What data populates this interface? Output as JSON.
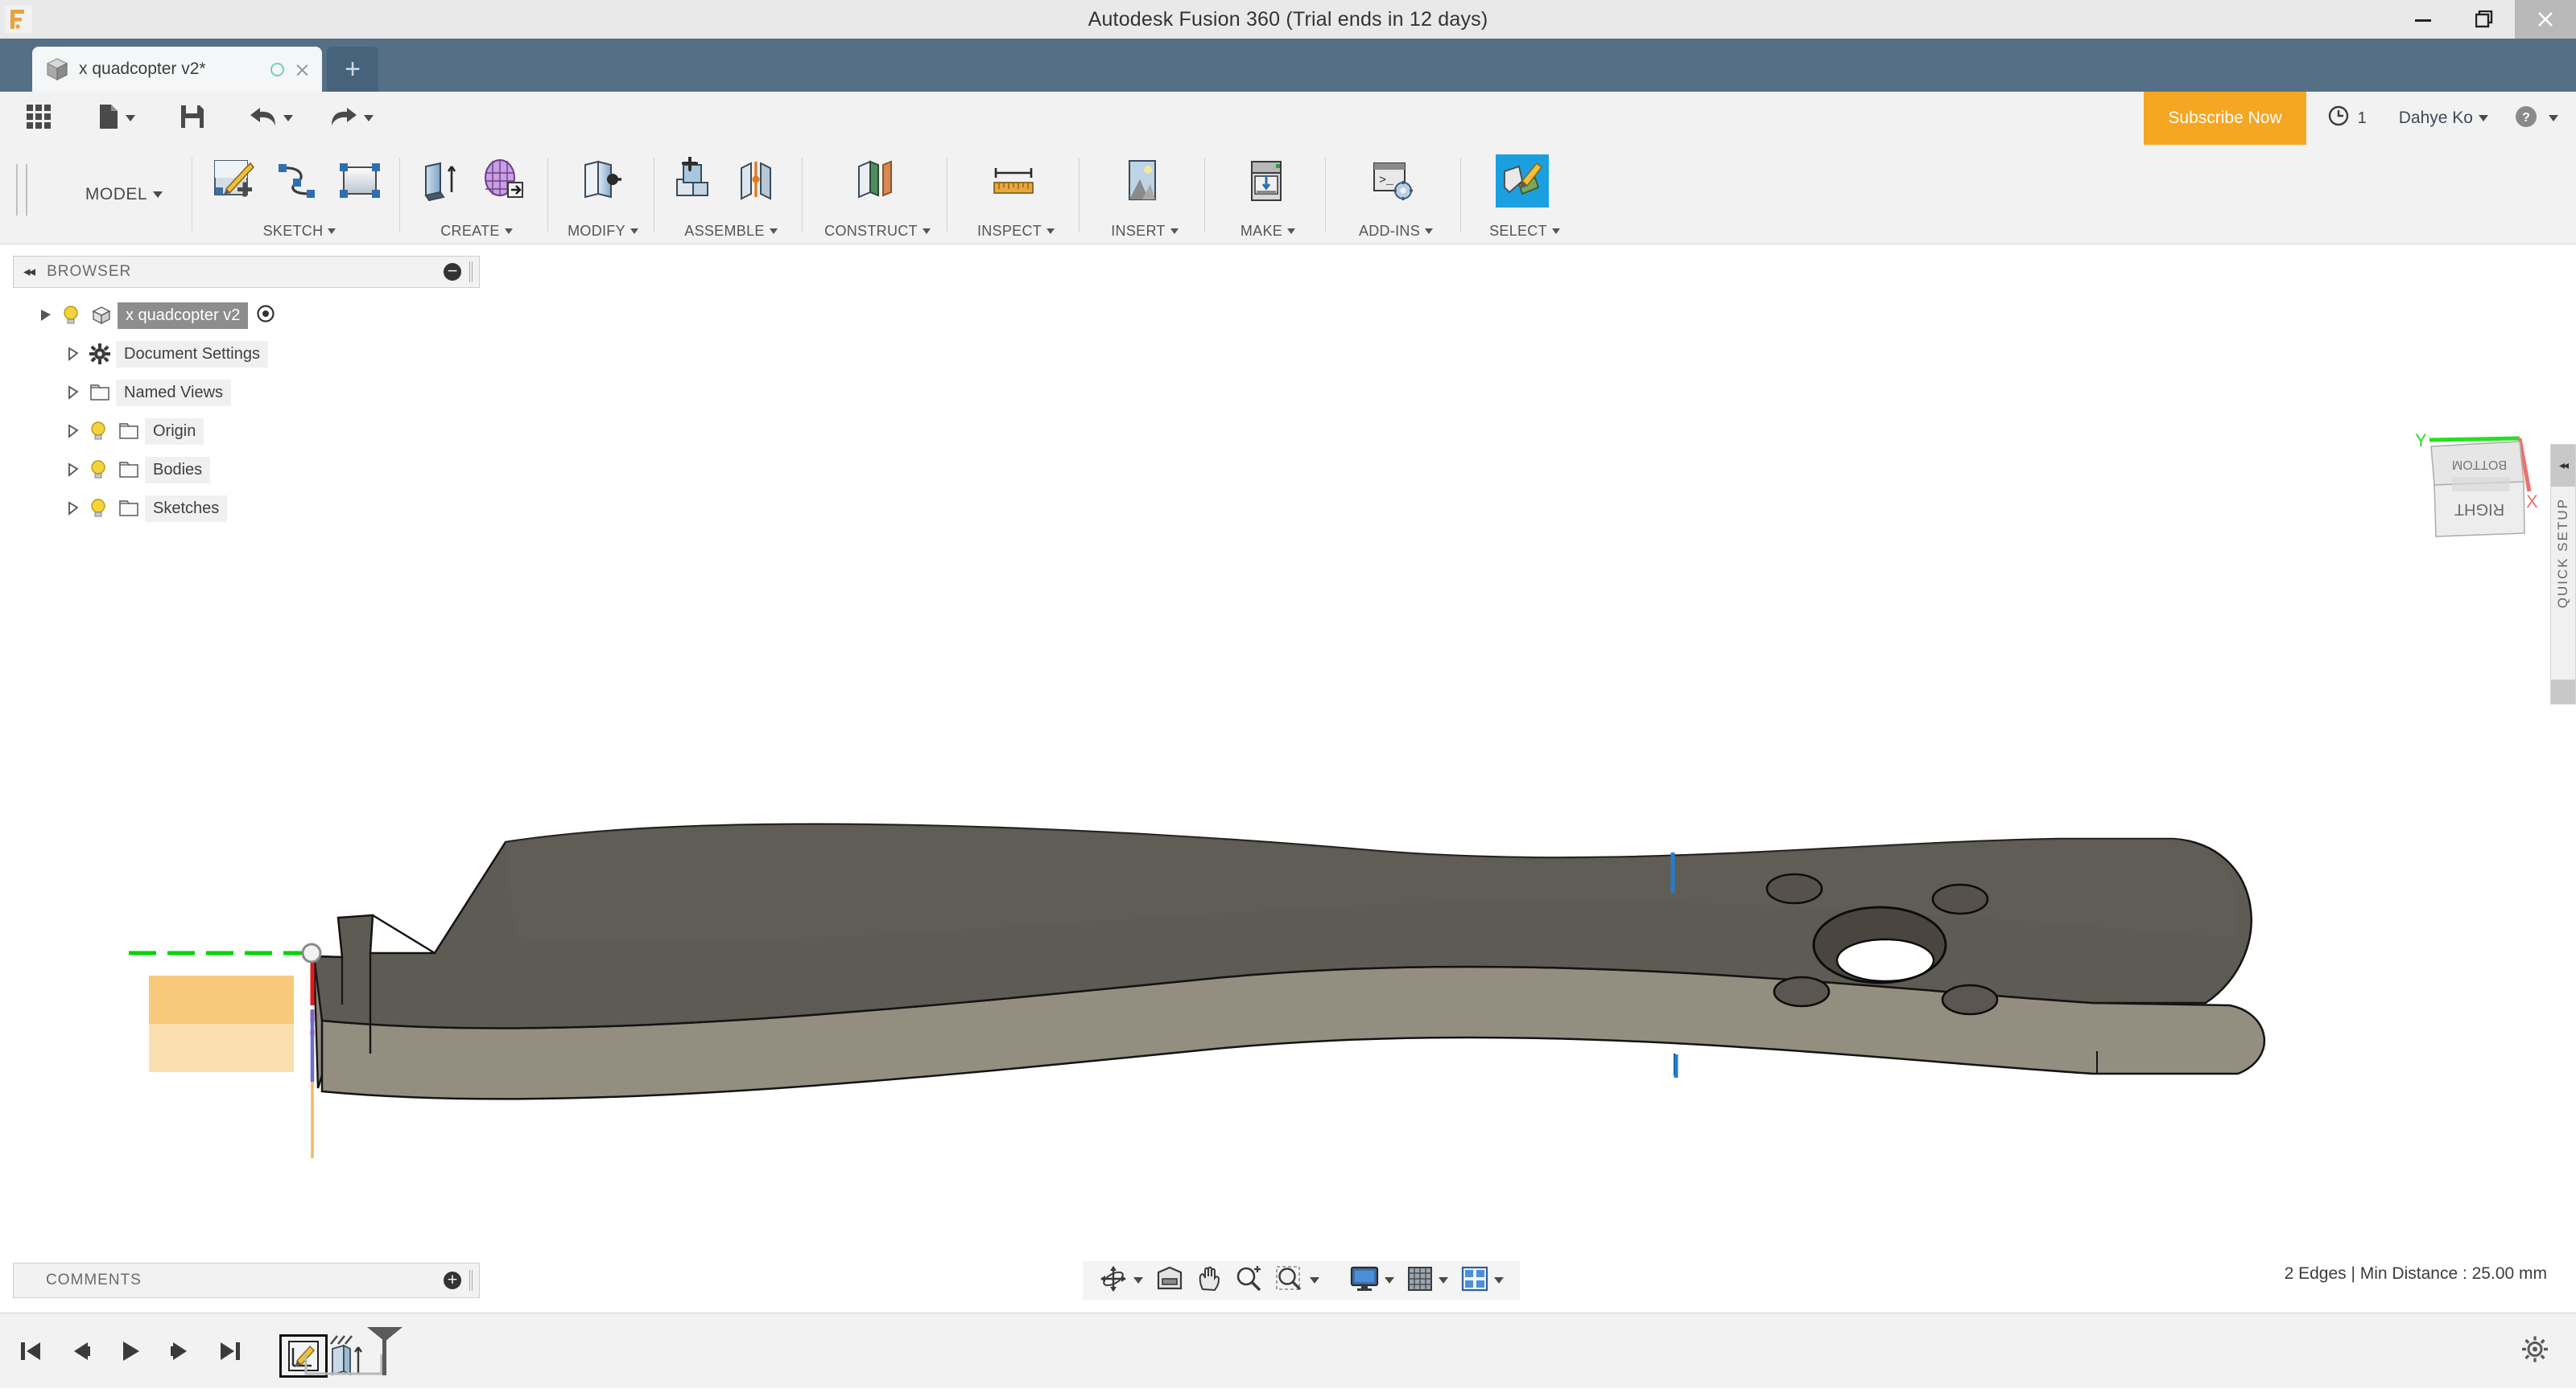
{
  "window": {
    "title": "Autodesk Fusion 360 (Trial ends in 12 days)",
    "app_logo": "F",
    "minimize_label": "minimize-icon",
    "restore_label": "restore-icon",
    "close_label": "close-icon"
  },
  "tabs": {
    "document": {
      "label": "x quadcopter v2*",
      "close_label": "×"
    },
    "new_tab_label": "+"
  },
  "quick_access": {
    "items": [
      {
        "name": "app-grid",
        "label": "grid-icon"
      },
      {
        "name": "new-file",
        "label": "file-icon"
      },
      {
        "name": "save",
        "label": "save-icon"
      },
      {
        "name": "undo",
        "label": "undo-icon"
      },
      {
        "name": "redo",
        "label": "redo-icon"
      }
    ],
    "subscribe_label": "Subscribe Now",
    "notification_count": "1",
    "user_name": "Dahye Ko",
    "help_label": "?"
  },
  "ribbon": {
    "workspace_label": "MODEL",
    "panels": [
      {
        "title": "SKETCH",
        "icons": [
          "create-sketch-icon",
          "spline-icon",
          "rectangle-icon"
        ]
      },
      {
        "title": "CREATE",
        "icons": [
          "extrude-icon",
          "create-form-icon"
        ]
      },
      {
        "title": "MODIFY",
        "icons": [
          "press-pull-icon"
        ]
      },
      {
        "title": "ASSEMBLE",
        "icons": [
          "new-component-icon",
          "joint-icon"
        ]
      },
      {
        "title": "CONSTRUCT",
        "icons": [
          "offset-plane-icon"
        ]
      },
      {
        "title": "INSPECT",
        "icons": [
          "measure-icon"
        ]
      },
      {
        "title": "INSERT",
        "icons": [
          "insert-image-icon"
        ]
      },
      {
        "title": "MAKE",
        "icons": [
          "3d-print-icon"
        ]
      },
      {
        "title": "ADD-INS",
        "icons": [
          "scripts-addins-icon"
        ]
      },
      {
        "title": "SELECT",
        "icons": [
          "select-icon"
        ],
        "active": true
      }
    ]
  },
  "browser": {
    "panel_title": "BROWSER",
    "tree": [
      {
        "label": "x quadcopter v2",
        "icon": "component-icon",
        "bulb": true,
        "selected": true,
        "radio": true,
        "indent": 0,
        "expanded": true
      },
      {
        "label": "Document Settings",
        "icon": "gear-icon",
        "bulb": false,
        "selected": false,
        "radio": false,
        "indent": 1,
        "expanded": false
      },
      {
        "label": "Named Views",
        "icon": "folder-icon",
        "bulb": false,
        "selected": false,
        "radio": false,
        "indent": 1,
        "expanded": false
      },
      {
        "label": "Origin",
        "icon": "folder-icon",
        "bulb": true,
        "selected": false,
        "radio": false,
        "indent": 1,
        "expanded": false
      },
      {
        "label": "Bodies",
        "icon": "folder-icon",
        "bulb": true,
        "selected": false,
        "radio": false,
        "indent": 1,
        "expanded": false
      },
      {
        "label": "Sketches",
        "icon": "folder-icon",
        "bulb": true,
        "selected": false,
        "radio": false,
        "indent": 1,
        "expanded": false
      }
    ]
  },
  "comments": {
    "panel_title": "COMMENTS",
    "add_label": "+"
  },
  "quick_setup": {
    "label": "QUICK SETUP"
  },
  "viewcube": {
    "face_front": "RIGHT",
    "face_top": "BOTTOM",
    "axis_y_label": "Y",
    "axis_x_label": "X",
    "axis_y_color": "#25e025",
    "axis_x_color": "#f07070"
  },
  "navbar": {
    "items": [
      {
        "name": "orbit-icon",
        "has_caret": true
      },
      {
        "name": "look-at-icon",
        "has_caret": false
      },
      {
        "name": "pan-icon",
        "has_caret": false
      },
      {
        "name": "zoom-icon",
        "has_caret": false
      },
      {
        "name": "zoom-window-icon",
        "has_caret": true
      },
      {
        "name": "display-settings-icon",
        "has_caret": true
      },
      {
        "name": "grid-snaps-icon",
        "has_caret": true
      },
      {
        "name": "viewports-icon",
        "has_caret": true
      }
    ]
  },
  "status_bar": {
    "text": "2 Edges | Min Distance : 25.00 mm"
  },
  "timeline": {
    "controls": [
      {
        "name": "jump-to-beginning-icon"
      },
      {
        "name": "step-back-icon"
      },
      {
        "name": "play-icon"
      },
      {
        "name": "step-forward-icon"
      },
      {
        "name": "jump-to-end-icon"
      }
    ],
    "features": [
      {
        "name": "timeline-sketch-feature",
        "label": "sketch-icon",
        "active": true
      },
      {
        "name": "timeline-extrude-feature",
        "label": "extrude-icon",
        "active": false
      }
    ],
    "settings_label": "gear-icon"
  },
  "canvas": {
    "model_name": "quadcopter arm",
    "colors": {
      "top_face": "#5d5a53",
      "side_face": "#938d80",
      "edge": "#1a1a1a",
      "selected_edge": "#1f7fd0",
      "sketch_fill_dark": "#f8c97b",
      "sketch_fill_light": "#fbdfb0",
      "axis_x": "#00d400",
      "axis_z_red": "#e01b1b",
      "axis_z_blue": "#6b6bd8",
      "axis_y_orange": "#f5b86a",
      "origin_point": "#dddddd"
    },
    "selected_edge_count": 2
  }
}
